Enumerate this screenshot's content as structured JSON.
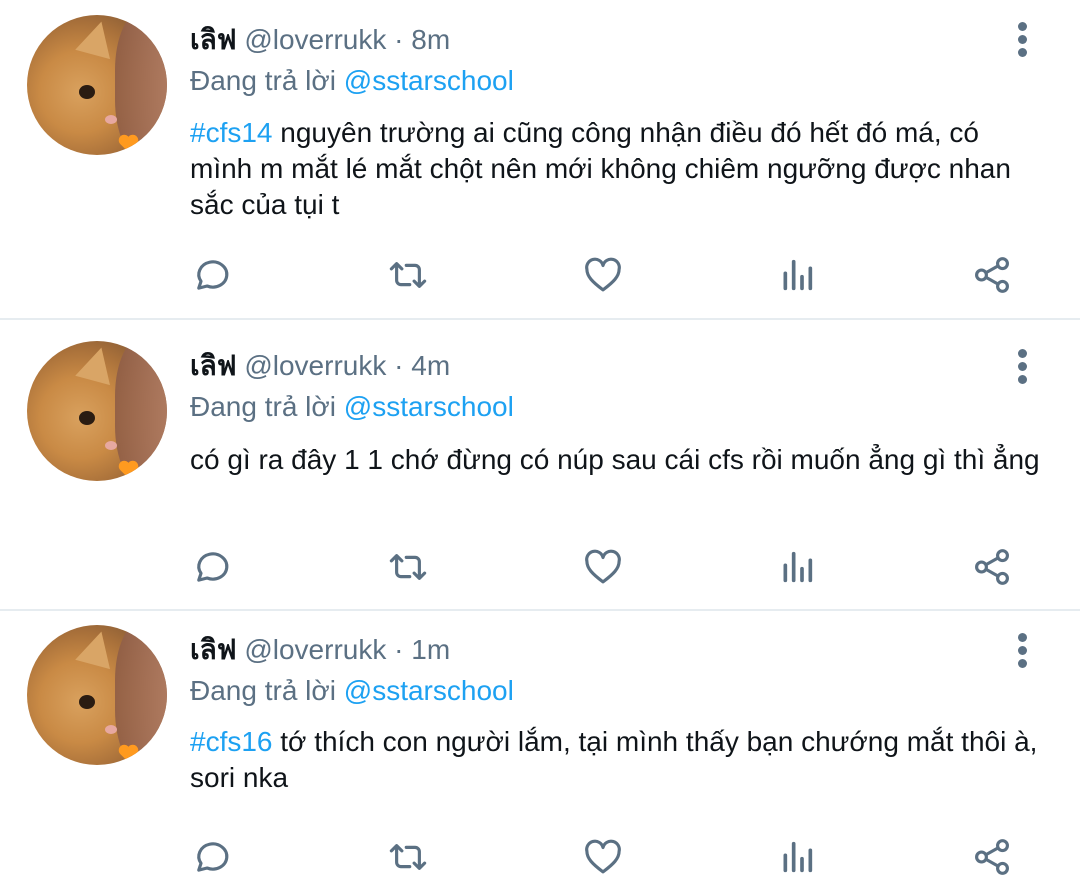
{
  "tweets": [
    {
      "name": "เลิฟ",
      "handle": "@loverrukk",
      "separator": "·",
      "time": "8m",
      "reply_prefix": "Đang trả lời",
      "reply_mention": "@sstarschool",
      "hashtag": "#cfs14",
      "text": " nguyên trường ai cũng công nhận điều đó hết đó má, có mình m mắt lé mắt chột nên mới không chiêm ngưỡng được nhan sắc của tụi t"
    },
    {
      "name": "เลิฟ",
      "handle": "@loverrukk",
      "separator": "·",
      "time": "4m",
      "reply_prefix": "Đang trả lời",
      "reply_mention": "@sstarschool",
      "hashtag": "",
      "text": "có gì ra đây 1 1 chớ đừng có núp sau cái cfs rồi muốn ẳng gì thì ẳng"
    },
    {
      "name": "เลิฟ",
      "handle": "@loverrukk",
      "separator": "·",
      "time": "1m",
      "reply_prefix": "Đang trả lời",
      "reply_mention": "@sstarschool",
      "hashtag": "#cfs16",
      "text": " tớ thích con người lắm, tại mình thấy bạn chướng mắt thôi à, sori nka"
    }
  ],
  "actions": [
    "reply-icon",
    "retweet-icon",
    "like-icon",
    "analytics-icon",
    "share-icon"
  ],
  "colors": {
    "accent": "#1da1f2",
    "secondary_text": "#5b7083",
    "primary_text": "#0f1419",
    "divider": "#e6ecf0"
  }
}
